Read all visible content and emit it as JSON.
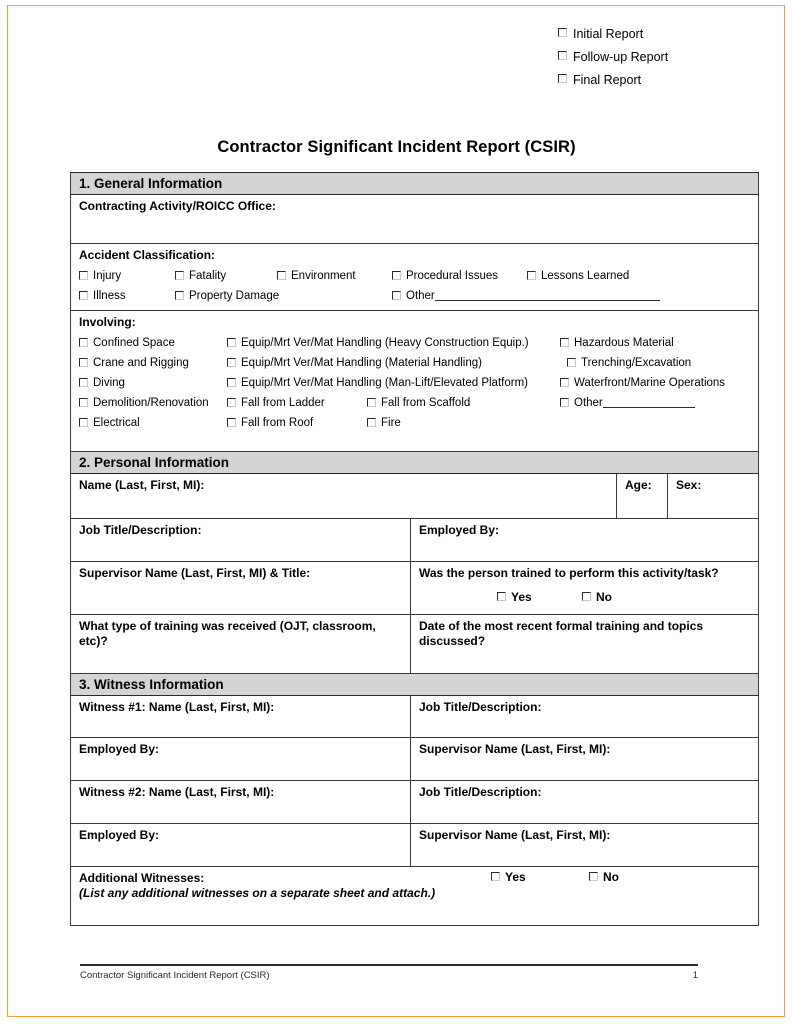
{
  "page": {
    "title": "Contractor Significant Incident Report (CSIR)",
    "border_color": "#f0a03c",
    "section_header_bg": "#d4d4d4"
  },
  "report_types": [
    {
      "label": "Initial Report"
    },
    {
      "label": "Follow-up Report"
    },
    {
      "label": "Final Report"
    }
  ],
  "sections": {
    "general": {
      "heading": "1. General Information",
      "contracting_activity_label": "Contracting Activity/ROICC Office:",
      "accident_classification_label": "Accident Classification:",
      "classification_row1": [
        "Injury",
        "Fatality",
        "Environment",
        "Procedural Issues",
        "Lessons Learned"
      ],
      "classification_row2": [
        "Illness",
        "Property Damage"
      ],
      "classification_other": "Other",
      "involving_label": "Involving:",
      "involving_rows": [
        [
          "Confined Space",
          "Equip/Mrt Ver/Mat Handling (Heavy Construction Equip.)",
          "Hazardous Material"
        ],
        [
          "Crane and Rigging",
          "Equip/Mrt Ver/Mat Handling (Material Handling)",
          "Trenching/Excavation"
        ],
        [
          "Diving",
          "Equip/Mrt Ver/Mat Handling (Man-Lift/Elevated Platform)",
          "Waterfront/Marine Operations"
        ],
        [
          "Demolition/Renovation",
          "Fall from Ladder",
          "Fall from Scaffold",
          "Other"
        ],
        [
          "Electrical",
          "Fall from Roof",
          "Fire"
        ]
      ]
    },
    "personal": {
      "heading": "2.  Personal Information",
      "name_label": "Name (Last, First, MI):",
      "age_label": "Age:",
      "sex_label": "Sex:",
      "job_title_label": "Job Title/Description:",
      "employed_by_label": "Employed By:",
      "supervisor_label": "Supervisor Name (Last, First, MI) & Title:",
      "trained_question": "Was the person trained to perform this activity/task?",
      "trained_yes": "Yes",
      "trained_no": "No",
      "training_type_label": "What type of training was received (OJT, classroom, etc)?",
      "training_date_label": "Date of the most recent formal training and topics discussed?"
    },
    "witness": {
      "heading": "3. Witness Information",
      "rows": [
        {
          "left": "Witness #1: Name (Last, First, MI):",
          "right": "Job Title/Description:"
        },
        {
          "left": "Employed By:",
          "right": "Supervisor Name (Last, First, MI):"
        },
        {
          "left": "Witness #2: Name (Last, First, MI):",
          "right": "Job Title/Description:"
        },
        {
          "left": "Employed By:",
          "right": "Supervisor Name (Last, First, MI):"
        }
      ],
      "additional_label": "Additional Witnesses:",
      "additional_note": "(List any additional witnesses on a separate sheet and attach.)",
      "additional_yes": "Yes",
      "additional_no": "No"
    }
  },
  "footer": {
    "text": "Contractor Significant Incident Report (CSIR)",
    "page_number": "1"
  }
}
